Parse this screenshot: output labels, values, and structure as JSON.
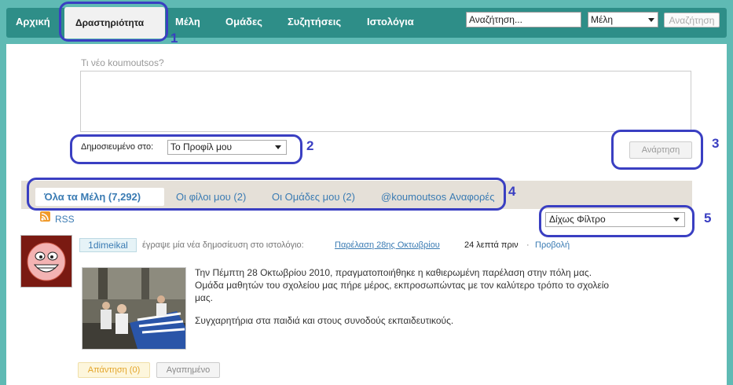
{
  "nav": {
    "items": [
      {
        "label": "Αρχική"
      },
      {
        "label": "Δραστηριότητα"
      },
      {
        "label": "Μέλη"
      },
      {
        "label": "Ομάδες"
      },
      {
        "label": "Συζητήσεις"
      },
      {
        "label": "Ιστολόγια"
      }
    ],
    "active_index": 1,
    "search_placeholder": "Αναζήτηση...",
    "search_scope": "Μέλη",
    "search_button": "Αναζήτηση"
  },
  "composer": {
    "prompt": "Τι νέο koumoutsos?",
    "publish_label": "Δημοσιευμένο στο:",
    "publish_target": "Το Προφίλ μου",
    "post_button": "Ανάρτηση"
  },
  "tabs": {
    "items": [
      {
        "label": "Όλα τα Μέλη (7,292)"
      },
      {
        "label": "Οι φίλοι μου (2)"
      },
      {
        "label": "Οι Ομάδες μου (2)"
      },
      {
        "label": "@koumoutsos Αναφορές"
      }
    ],
    "active_index": 0,
    "rss_label": "RSS",
    "filter_value": "Δίχως Φίλτρο"
  },
  "activity": {
    "user": "1dimeikal",
    "action": "έγραψε μία νέα δημοσίευση στο ιστολόγιο:",
    "post_title": "Παρέλαση 28ης Οκτωβρίου",
    "time": "24 λεπτά πριν",
    "separator": "·",
    "view_link": "Προβολή",
    "body_lines": [
      "Την Πέμπτη 28 Οκτωβρίου 2010,  πραγματοποιήθηκε η καθιερωμένη παρέλαση στην πόλη μας.",
      "Ομάδα μαθητών του σχολείου μας πήρε μέρος, εκπροσωπώντας με τον καλύτερο τρόπο το σχολείο",
      "μας.",
      "Συγχαρητήρια στα παιδιά και στους συνοδούς εκπαιδευτικούς."
    ],
    "reply_button": "Απάντηση (0)",
    "favorite_button": "Αγαπημένο"
  },
  "annotations": [
    "1",
    "2",
    "3",
    "4",
    "5"
  ],
  "colors": {
    "nav_bg": "#2e8e88",
    "page_edge": "#5fbab4",
    "link": "#3a7bb3",
    "annotation": "#3a3fc2"
  }
}
